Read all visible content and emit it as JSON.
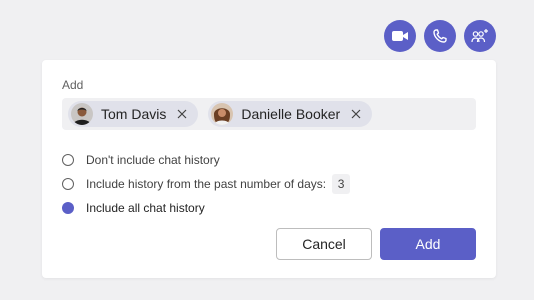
{
  "header_actions": {
    "video_icon": "video-camera-icon",
    "call_icon": "phone-icon",
    "add_people_icon": "add-people-icon",
    "accent_color": "#5b5fc7"
  },
  "dialog": {
    "add_label": "Add",
    "people": [
      {
        "name": "Tom Davis"
      },
      {
        "name": "Danielle Booker"
      }
    ],
    "history_options": [
      {
        "label": "Don't include chat history",
        "selected": false
      },
      {
        "label": "Include history from the past number of days:",
        "selected": false,
        "days": "3"
      },
      {
        "label": "Include all chat history",
        "selected": true
      }
    ],
    "cancel_label": "Cancel",
    "add_button_label": "Add"
  }
}
